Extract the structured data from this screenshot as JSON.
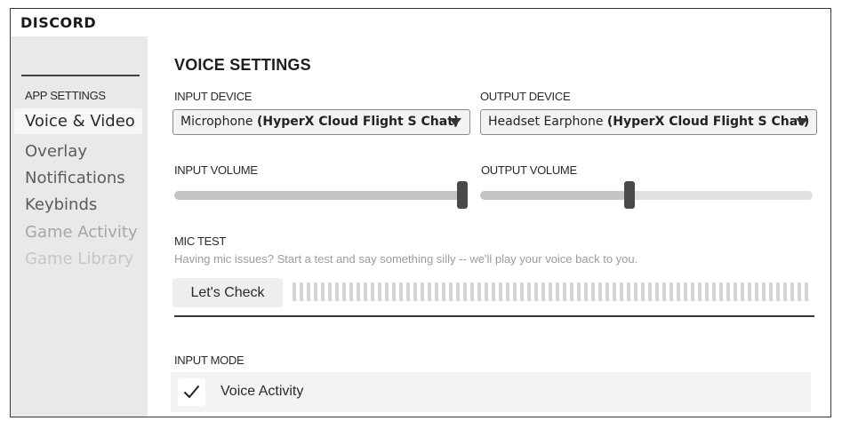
{
  "app": {
    "brand": "DISCORD"
  },
  "sidebar": {
    "heading": "APP SETTINGS",
    "items": [
      {
        "label": "Voice & Video",
        "state": "active"
      },
      {
        "label": "Overlay",
        "state": "normal"
      },
      {
        "label": "Notifications",
        "state": "normal"
      },
      {
        "label": "Keybinds",
        "state": "normal"
      },
      {
        "label": "Game Activity",
        "state": "dim"
      },
      {
        "label": "Game Library",
        "state": "dimmer"
      }
    ]
  },
  "main": {
    "title": "VOICE SETTINGS",
    "input_device": {
      "label": "INPUT DEVICE",
      "value_prefix": "Microphone ",
      "value_bold": "(HyperX Cloud Flight S Chat)"
    },
    "output_device": {
      "label": "OUTPUT DEVICE",
      "value_prefix": "Headset Earphone ",
      "value_bold": "(HyperX Cloud Flight S Chat)"
    },
    "input_volume": {
      "label": "INPUT VOLUME",
      "level_percent": 100
    },
    "output_volume": {
      "label": "OUTPUT VOLUME",
      "level_percent": 45
    },
    "mic_test": {
      "label": "MIC TEST",
      "description": "Having mic issues?  Start a test and say something silly -- we'll play your voice back to you.",
      "button_label": "Let's Check"
    },
    "input_mode": {
      "label": "INPUT MODE",
      "option_label": "Voice Activity",
      "checked": true
    }
  },
  "colors": {
    "sidebar_bg": "#e9e9e9",
    "slider_knob": "#4a4a4a",
    "slider_fill": "#c4c4c4"
  },
  "icons": {
    "dropdown": "chevron-down-icon",
    "check": "checkmark-icon"
  }
}
